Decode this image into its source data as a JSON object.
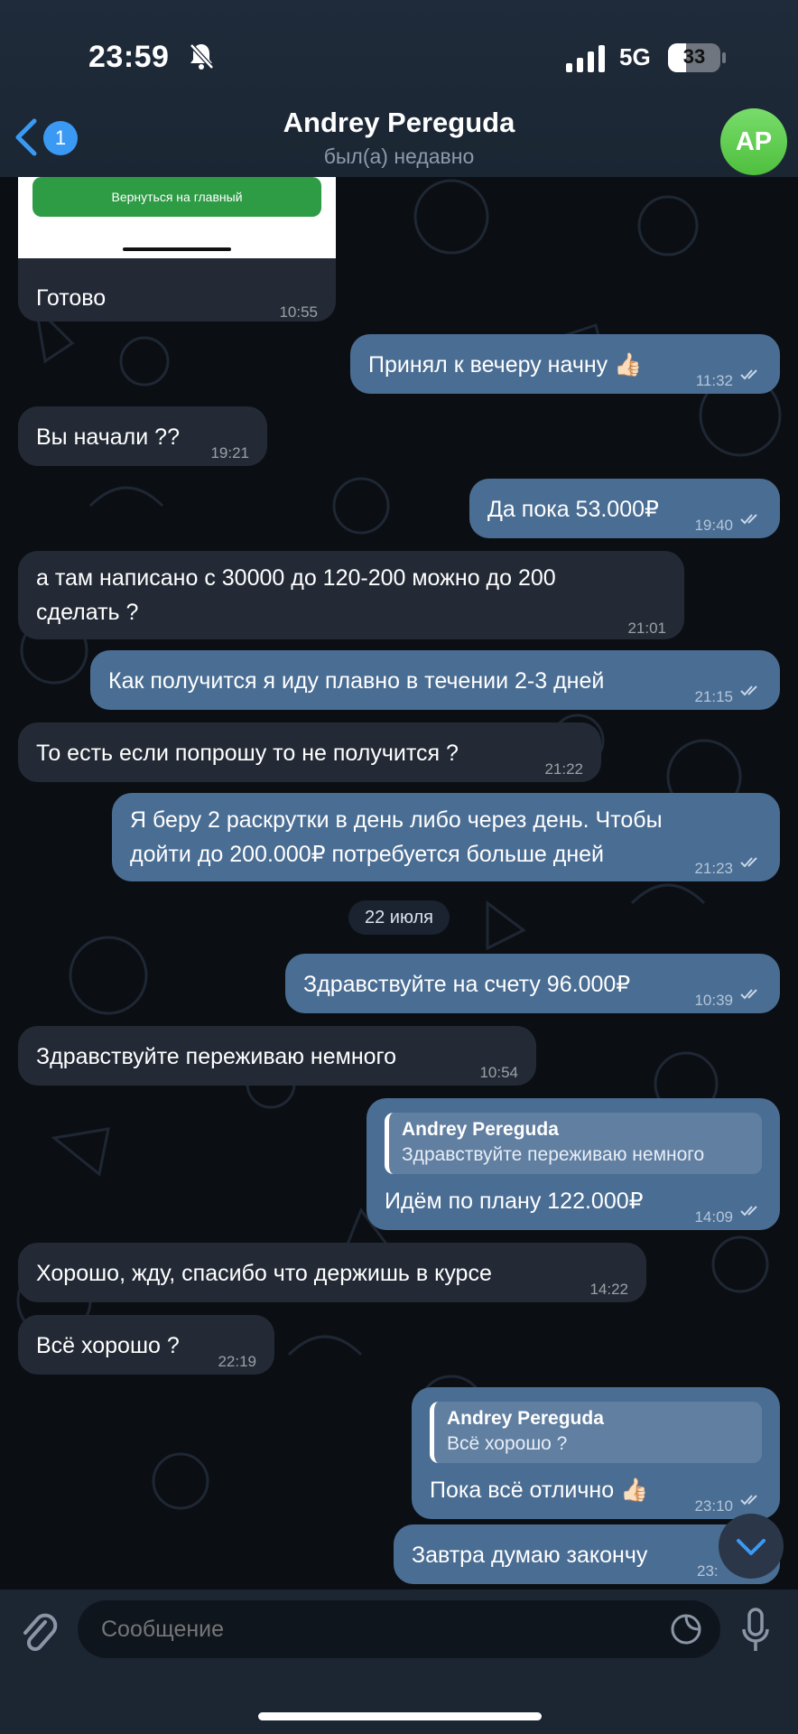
{
  "status_bar": {
    "time": "23:59",
    "network": "5G",
    "battery": "33"
  },
  "header": {
    "back_badge": "1",
    "contact_name": "Andrey Pereguda",
    "last_seen": "был(а) недавно",
    "avatar_initials": "AP"
  },
  "preview_button_label": "Вернуться на главный",
  "date_separator": "22 июля",
  "messages": [
    {
      "direction": "in",
      "text": "Готово",
      "time": "10:55"
    },
    {
      "direction": "out",
      "text": "Принял к вечеру начну 👍🏻",
      "time": "11:32"
    },
    {
      "direction": "in",
      "text": "Вы начали ??",
      "time": "19:21"
    },
    {
      "direction": "out",
      "text": "Да пока 53.000₽",
      "time": "19:40"
    },
    {
      "direction": "in",
      "text_line1": "а там написано с 30000 до 120-200 можно до 200",
      "text_line2": "сделать ?",
      "time": "21:01"
    },
    {
      "direction": "out",
      "text": "Как получится я иду плавно в течении 2-3 дней",
      "time": "21:15"
    },
    {
      "direction": "in",
      "text": "То есть если попрошу то не получится ?",
      "time": "21:22"
    },
    {
      "direction": "out",
      "text_line1": "Я беру 2 раскрутки в день либо через день. Чтобы",
      "text_line2": "дойти до 200.000₽ потребуется больше дней",
      "time": "21:23"
    },
    {
      "direction": "out",
      "text": "Здравствуйте на счету 96.000₽",
      "time": "10:39"
    },
    {
      "direction": "in",
      "text": "Здравствуйте переживаю немного",
      "time": "10:54"
    },
    {
      "direction": "out",
      "reply_name": "Andrey Pereguda",
      "reply_text": "Здравствуйте переживаю немного",
      "text": "Идём по плану 122.000₽",
      "time": "14:09"
    },
    {
      "direction": "in",
      "text": "Хорошо, жду, спасибо что держишь в курсе",
      "time": "14:22"
    },
    {
      "direction": "in",
      "text": "Всё хорошо ?",
      "time": "22:19"
    },
    {
      "direction": "out",
      "reply_name": "Andrey Pereguda",
      "reply_text": "Всё хорошо ?",
      "text": "Пока всё отлично 👍🏻",
      "time": "23:10"
    },
    {
      "direction": "out",
      "text": "Завтра думаю закончу",
      "time": "23:"
    }
  ],
  "composer": {
    "placeholder": "Сообщение"
  },
  "icons": [
    "bell-slash-icon",
    "signal-icon",
    "back-chevron-icon",
    "double-check-icon",
    "scroll-down-icon",
    "attach-icon",
    "sticker-icon",
    "mic-icon"
  ],
  "colors": {
    "outgoing_bubble": "#4a6d93",
    "incoming_bubble": "#232a36",
    "accent": "#3a9af3",
    "avatar": "#5cc84b"
  }
}
